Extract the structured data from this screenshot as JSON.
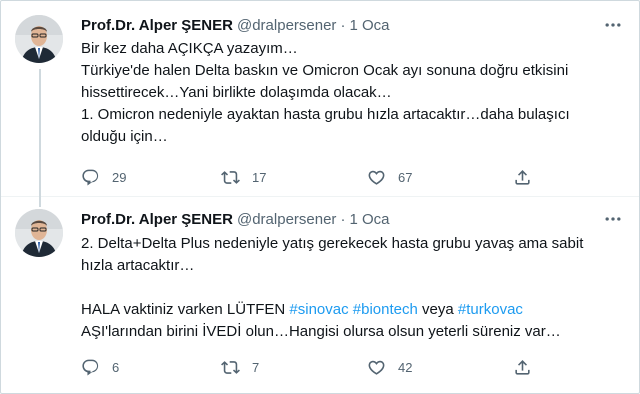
{
  "tweets": [
    {
      "author_name": "Prof.Dr. Alper ŞENER",
      "handle": "@dralpersener",
      "separator": "·",
      "time": "1 Oca",
      "lines": [
        "Bir kez daha AÇIKÇA yazayım…",
        "Türkiye'de halen Delta baskın ve Omicron Ocak ayı sonuna doğru etkisini",
        "hissettirecek…Yani birlikte dolaşımda olacak…",
        "1. Omicron nedeniyle ayaktan hasta grubu hızla artacaktır…daha bulaşıcı",
        "olduğu için…"
      ],
      "reply_count": "29",
      "retweet_count": "17",
      "like_count": "67"
    },
    {
      "author_name": "Prof.Dr. Alper ŞENER",
      "handle": "@dralpersener",
      "separator": "·",
      "time": "1 Oca",
      "lines": [
        "2. Delta+Delta Plus nedeniyle yatış gerekecek hasta grubu yavaş ama sabit",
        "hızla artacaktır…"
      ],
      "hashtag_line": {
        "prefix": "HALA vaktiniz varken LÜTFEN ",
        "tag1": "#sinovac",
        "tag2": "#biontech",
        "middle": " veya ",
        "tag3": "#turkovac"
      },
      "last_line": "AŞI'larından birini İVEDİ olun…Hangisi olursa olsun yeterli süreniz var…",
      "reply_count": "6",
      "retweet_count": "7",
      "like_count": "42"
    }
  ],
  "icons": {
    "reply": "reply-icon",
    "retweet": "retweet-icon",
    "like": "heart-icon",
    "share": "share-icon",
    "more": "more-icon"
  },
  "colors": {
    "text": "#0f1419",
    "secondary": "#536471",
    "hashtag": "#1d9bf0",
    "border": "#cfd9de"
  }
}
